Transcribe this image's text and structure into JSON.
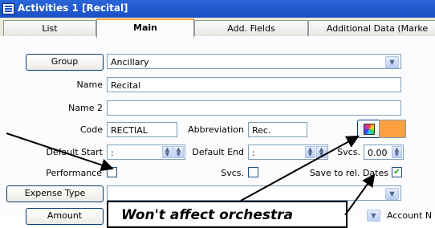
{
  "window": {
    "title": "Activities  1  [Recital]",
    "icon": "window-icon"
  },
  "tabs": [
    {
      "label": "List",
      "active": false
    },
    {
      "label": "Main",
      "active": true
    },
    {
      "label": "Add. Fields",
      "active": false
    },
    {
      "label": "Additional Data (Marke",
      "active": false
    }
  ],
  "form": {
    "group_button": "Group",
    "group_value": "Ancillary",
    "name_label": "Name",
    "name_value": "Recital",
    "name2_label": "Name 2",
    "name2_value": "",
    "code_label": "Code",
    "code_value": "RECTIAL",
    "abbreviation_label": "Abbreviation",
    "abbreviation_value": "Rec.",
    "default_start_label": "Default Start",
    "default_start_value": ":",
    "default_end_label": "Default End",
    "default_end_value": ":",
    "svcs_label": "Svcs.",
    "svcs_value": "0.00",
    "performance_label": "Performance",
    "performance_checked": false,
    "svcs_check_label": "Svcs.",
    "svcs_checked": false,
    "save_to_rel_dates_label": "Save to rel. Dates",
    "save_to_rel_dates_checked": true,
    "expense_type_button": "Expense Type",
    "expense_type_value": "",
    "amount_button": "Amount",
    "account_label": "Account N",
    "color_value": "#ffa040"
  },
  "annotation": {
    "callout_text": "Won't affect orchestra"
  }
}
